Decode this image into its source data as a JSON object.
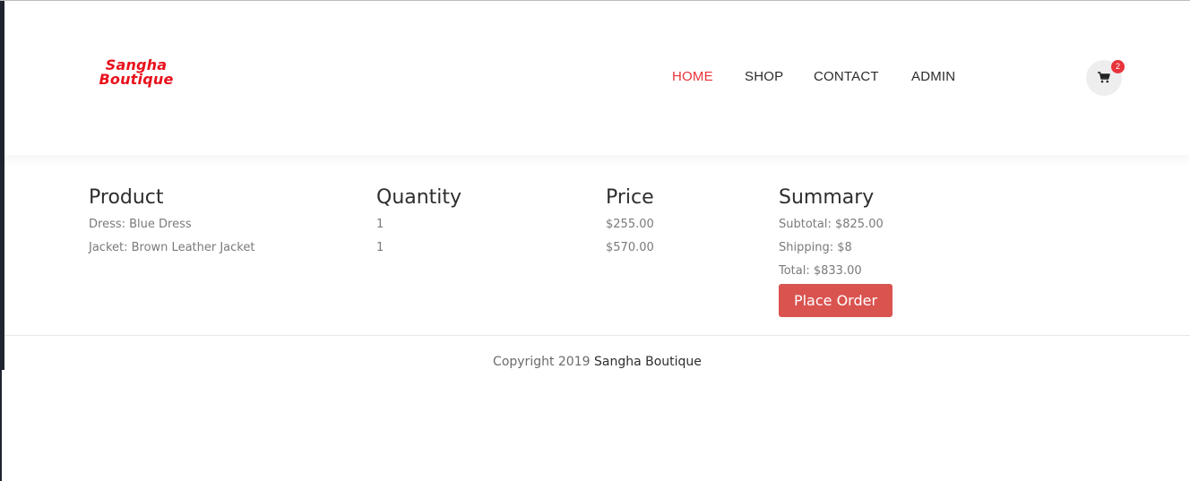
{
  "brand": {
    "logo_line1": "Sangha",
    "logo_line2": "Boutique",
    "color": "#e8111c"
  },
  "nav": {
    "items": [
      {
        "label": "HOME",
        "active": true
      },
      {
        "label": "SHOP",
        "active": false
      },
      {
        "label": "CONTACT",
        "active": false
      },
      {
        "label": "ADMIN",
        "active": false
      }
    ],
    "active_color": "#e8333b"
  },
  "cart": {
    "icon": "shopping-cart-icon",
    "count": "2"
  },
  "table": {
    "headers": {
      "product": "Product",
      "quantity": "Quantity",
      "price": "Price",
      "summary": "Summary"
    },
    "rows": [
      {
        "product": "Dress: Blue Dress",
        "quantity": "1",
        "price": "$255.00"
      },
      {
        "product": "Jacket: Brown Leather Jacket",
        "quantity": "1",
        "price": "$570.00"
      }
    ]
  },
  "summary": {
    "subtotal": "Subtotal: $825.00",
    "shipping": "Shipping: $8",
    "total": "Total: $833.00",
    "place_order_label": "Place Order",
    "button_color": "#d9534f"
  },
  "footer": {
    "copyright": "Copyright 2019",
    "brand": "Sangha Boutique"
  }
}
